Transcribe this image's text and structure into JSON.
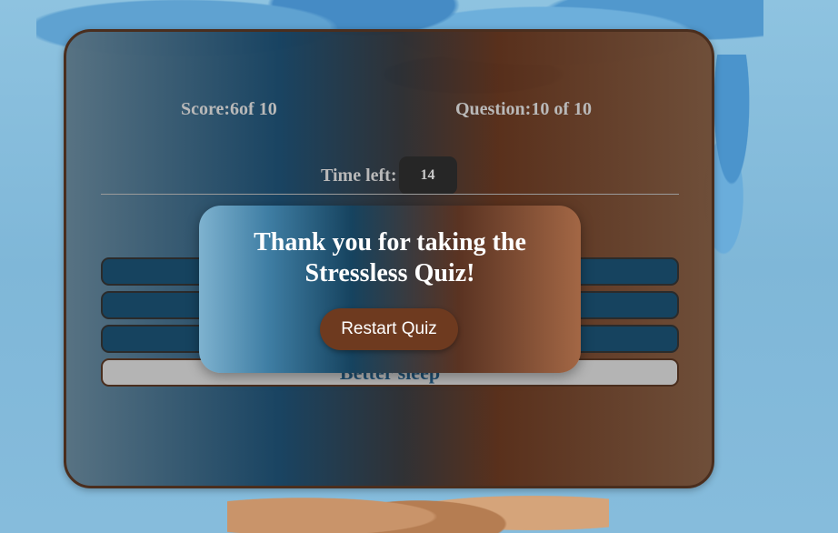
{
  "quiz": {
    "score_text": "Score:6of 10",
    "question_counter_text": "Question:10 of 10",
    "timer_label": "Time left:",
    "timer_value": "14",
    "question_text": "",
    "options": [
      {
        "label": "",
        "selected": false
      },
      {
        "label": "",
        "selected": false
      },
      {
        "label": "",
        "selected": false
      },
      {
        "label": "Better sleep",
        "selected": true
      }
    ]
  },
  "modal": {
    "title": "Thank you for taking the Stressless Quiz!",
    "restart_label": "Restart Quiz"
  },
  "colors": {
    "option_default": "#16435f",
    "option_selected": "#b4b4b4",
    "restart_button": "#6e3a1f",
    "card_border": "#4a2e1e"
  }
}
